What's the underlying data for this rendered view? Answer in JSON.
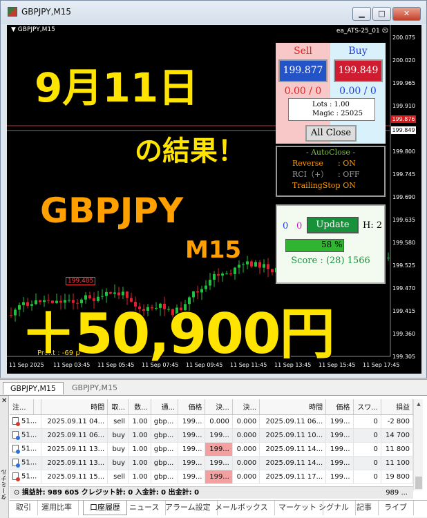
{
  "window": {
    "title": "GBPJPY,M15"
  },
  "chart": {
    "symbol_label": "GBPJPY,M15",
    "ea_label": "ea_ATS-25_01",
    "price_ticks": [
      "200.075",
      "200.020",
      "199.965",
      "199.910",
      "199.855",
      "199.800",
      "199.745",
      "199.690",
      "199.635",
      "199.580",
      "199.525",
      "199.470",
      "199.415",
      "199.360",
      "199.305"
    ],
    "time_ticks": [
      "11 Sep 2025",
      "11 Sep 03:45",
      "11 Sep 05:45",
      "11 Sep 07:45",
      "11 Sep 09:45",
      "11 Sep 11:45",
      "11 Sep 13:45",
      "11 Sep 15:45",
      "11 Sep 17:45"
    ],
    "sell_price_box": "199.876",
    "buy_price_box": "199.849",
    "last_box": "199.485",
    "profit_label": "Profit : -69 p",
    "up_color": "#21c040",
    "down_color": "#e02030"
  },
  "overlay": {
    "date": "9月11日",
    "result": "の結果！",
    "pair": "GBPJPY",
    "timeframe": "M15",
    "profit": "＋50,900円"
  },
  "panel": {
    "sell_title": "Sell",
    "buy_title": "Buy",
    "sell_price": "199.877",
    "buy_price": "199.849",
    "sell_count": "0.00 / 0",
    "buy_count": "0.00 / 0",
    "lots": "Lots   : 1.00",
    "magic": "Magic : 25025",
    "all_close": "All Close",
    "autoclose_title": "- AutoClose -",
    "autoclose": [
      {
        "key": "Reverse",
        "val": ": ON",
        "color": "#ff9a00"
      },
      {
        "key": "RCI（+）",
        "val": ": OFF",
        "color": "#9a9a9a"
      },
      {
        "key": "TrailingStop",
        "val": ": ON",
        "color": "#ff9a00"
      }
    ],
    "zero1": "0",
    "zero2": "0",
    "update": "Update",
    "h_value": "H: 2",
    "progress_percent": 58,
    "progress_text": "58 %",
    "score": "Score : (28) 1566"
  },
  "chart_tabs": [
    "GBPJPY,M15",
    "GBPJPY,M15"
  ],
  "terminal": {
    "side_label": "ターミナル",
    "headers": [
      "注...",
      "",
      "時間",
      "取...",
      "数...",
      "通...",
      "価格",
      "決...",
      "決...",
      "時間",
      "価格",
      "スワ...",
      "損益"
    ],
    "rows": [
      {
        "type": "sell",
        "order": "51...",
        "open_time": "2025.09.11 04...",
        "side": "sell",
        "vol": "1.00",
        "sym": "gbp...",
        "price": "199...",
        "sl": "0.000",
        "tp": "0.000",
        "close_time": "2025.09.11 06...",
        "close_price": "199...",
        "swap": "0",
        "profit": "-2 800",
        "hl": false
      },
      {
        "type": "buy",
        "order": "51...",
        "open_time": "2025.09.11 06...",
        "side": "buy",
        "vol": "1.00",
        "sym": "gbp...",
        "price": "199...",
        "sl": "199...",
        "tp": "0.000",
        "close_time": "2025.09.11 10...",
        "close_price": "199...",
        "swap": "0",
        "profit": "14 700",
        "hl": true
      },
      {
        "type": "buy",
        "order": "51...",
        "open_time": "2025.09.11 13...",
        "side": "buy",
        "vol": "1.00",
        "sym": "gbp...",
        "price": "199...",
        "sl": "199...",
        "tp": "0.000",
        "close_time": "2025.09.11 14...",
        "close_price": "199...",
        "swap": "0",
        "profit": "11 800",
        "hl": true
      },
      {
        "type": "buy",
        "order": "51...",
        "open_time": "2025.09.11 13...",
        "side": "buy",
        "vol": "1.00",
        "sym": "gbp...",
        "price": "199...",
        "sl": "199...",
        "tp": "0.000",
        "close_time": "2025.09.11 14...",
        "close_price": "199...",
        "swap": "0",
        "profit": "11 100",
        "hl": true
      },
      {
        "type": "sell",
        "order": "51...",
        "open_time": "2025.09.11 15...",
        "side": "sell",
        "vol": "1.00",
        "sym": "gbp...",
        "price": "199...",
        "sl": "199...",
        "tp": "0.000",
        "close_time": "2025.09.11 17...",
        "close_price": "199...",
        "swap": "0",
        "profit": "19 800",
        "hl": true
      }
    ],
    "summary": "損益計: 989 605  クレジット計: 0  入金計: 0  出金計: 0",
    "summary_right": "989 ...",
    "tabs": [
      "取引",
      "運用比率",
      "口座履歴",
      "ニュース",
      "アラーム設定",
      "メールボックス",
      "マーケット",
      "シグナル",
      "記事",
      "ライブ"
    ],
    "active_tab": 2
  }
}
